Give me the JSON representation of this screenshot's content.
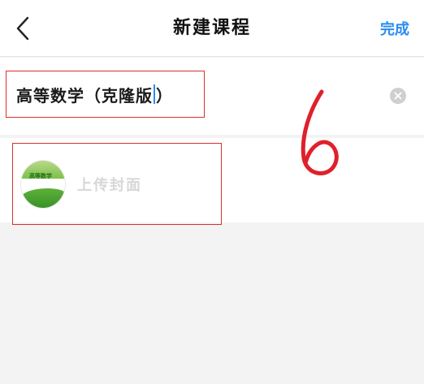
{
  "header": {
    "title": "新建课程",
    "done_label": "完成"
  },
  "course_name": {
    "value_before_caret": "高等数学（克隆版",
    "value_after_caret": "）"
  },
  "cover": {
    "thumbnail_title": "高等数学",
    "upload_label": "上传封面"
  },
  "annotation": {
    "text": "6"
  },
  "colors": {
    "accent": "#2a8cf0",
    "highlight_box": "#d9302c",
    "annotation": "#e0202a"
  }
}
